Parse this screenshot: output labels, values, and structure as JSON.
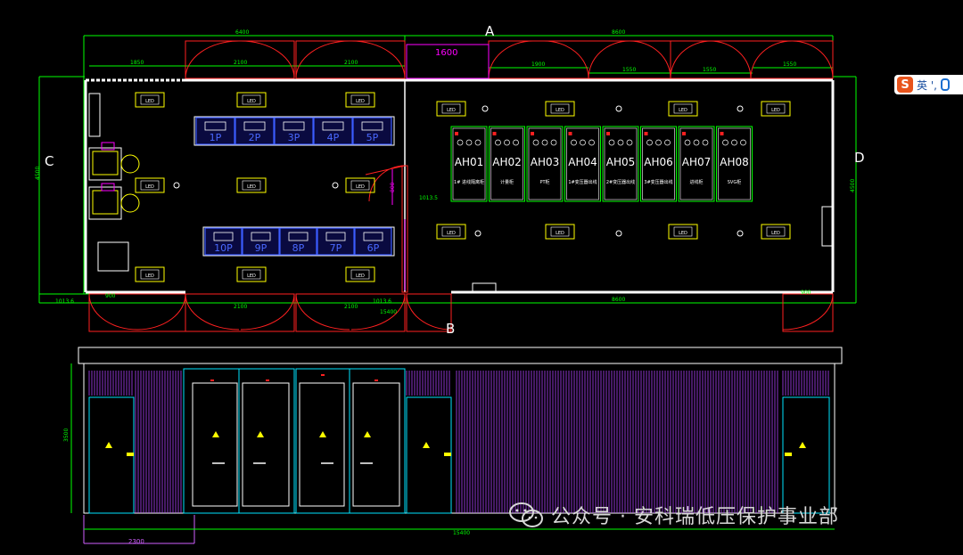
{
  "axes": {
    "A": "A",
    "B": "B",
    "C": "C",
    "D": "D"
  },
  "dims": {
    "top_left": "6400",
    "top_right": "8600",
    "door_pink": "1600",
    "d1850": "1850",
    "d2100a": "2100",
    "d2100b": "2100",
    "d1900": "1900",
    "d1550a": "1550",
    "d1550b": "1550",
    "d1550c": "1550",
    "bot_left": "1013.6",
    "bot_900a": "900",
    "bot_2100a": "2100",
    "bot_2100b": "2100",
    "bot_1013": "1013.6",
    "bot_8600": "8600",
    "bot_900b": "900",
    "bot_15400": "15400",
    "left_4500": "4500",
    "right_4500": "4500",
    "mid_800": "800",
    "mid_1013": "1013.5",
    "elev_3500": "3500",
    "elev_2300": "2300",
    "elev_total": "15400"
  },
  "low_panels_top": [
    "1P",
    "2P",
    "3P",
    "4P",
    "5P"
  ],
  "low_panels_bottom": [
    "10P",
    "9P",
    "8P",
    "7P",
    "6P"
  ],
  "hv_cabinets": [
    {
      "code": "AH01",
      "sub": "1# 进线隔离柜"
    },
    {
      "code": "AH02",
      "sub": "计量柜"
    },
    {
      "code": "AH03",
      "sub": "PT柜"
    },
    {
      "code": "AH04",
      "sub": "1#变压器出线"
    },
    {
      "code": "AH05",
      "sub": "2#变压器出线"
    },
    {
      "code": "AH06",
      "sub": "3#变压器出线"
    },
    {
      "code": "AH07",
      "sub": "进线柜"
    },
    {
      "code": "AH08",
      "sub": "SVG柜"
    }
  ],
  "light_label": "LED",
  "ime": {
    "badge": "S",
    "text": "英 ',"
  },
  "watermark": "公众号 · 安科瑞低压保护事业部",
  "colors": {
    "wall": "#ffffff",
    "dim": "#00ff00",
    "door": "#ff2020",
    "panel": "#3b5cff",
    "cab": "#00ff00",
    "mag": "#ff00ff",
    "cyan": "#00e5ff",
    "yellow": "#ffff00",
    "elev": "#d060ff"
  }
}
